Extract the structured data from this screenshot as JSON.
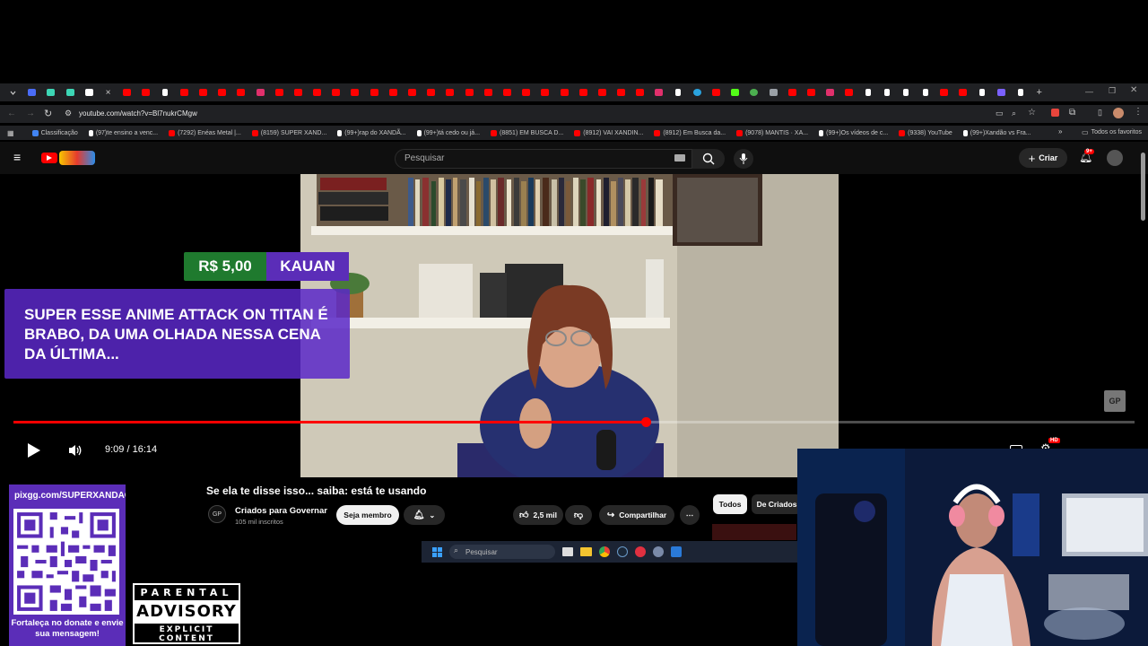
{
  "browser": {
    "url": "youtube.com/watch?v=Bl7nukrCMgw",
    "bookmarks": [
      {
        "label": "Classificação",
        "color": "#4285f4"
      },
      {
        "label": "(97)te ensino a venc...",
        "color": "#ffffff"
      },
      {
        "label": "(7292) Enéas Metal |...",
        "color": "#ff0000"
      },
      {
        "label": "(8159) SUPER XAND...",
        "color": "#ff0000"
      },
      {
        "label": "(99+)rap do XANDÃ...",
        "color": "#ffffff"
      },
      {
        "label": "(99+)tá cedo ou já...",
        "color": "#ffffff"
      },
      {
        "label": "(8851) EM BUSCA D...",
        "color": "#ff0000"
      },
      {
        "label": "(8912) VAI XANDIN...",
        "color": "#ff0000"
      },
      {
        "label": "(8912) Em Busca da...",
        "color": "#ff0000"
      },
      {
        "label": "(9078) MANTIS · XA...",
        "color": "#ff0000"
      },
      {
        "label": "(99+)Os vídeos de c...",
        "color": "#ffffff"
      },
      {
        "label": "(9338) YouTube",
        "color": "#ff0000"
      },
      {
        "label": "(99+)Xandão vs Fra...",
        "color": "#ffffff"
      }
    ],
    "all_bookmarks": "Todos os favoritos"
  },
  "youtube": {
    "search_placeholder": "Pesquisar",
    "create_label": "Criar",
    "notification_count": "9+"
  },
  "player": {
    "time": "9:09 / 16:14",
    "progress": 0.564
  },
  "overlay": {
    "amount": "R$ 5,00",
    "donor": "KAUAN",
    "message": "SUPER ESSE ANIME ATTACK ON TITAN É BRABO, DA UMA OLHADA NESSA CENA DA ÚLTIMA..."
  },
  "video": {
    "title": "Se ela te disse isso... saiba: está te usando",
    "channel": "Criados para Governar",
    "subscribers": "105 mil inscritos",
    "join_label": "Seja membro",
    "likes": "2,5 mil",
    "share_label": "Compartilhar",
    "chips": [
      "Todos",
      "De Criados"
    ]
  },
  "taskbar": {
    "search_placeholder": "Pesquisar"
  },
  "donate": {
    "url": "pixgg.com/SUPERXANDAO",
    "cta": "Fortaleça no donate e envie sua mensagem!"
  },
  "advisory": {
    "top": "PARENTAL",
    "mid": "ADVISORY",
    "bottom": "EXPLICIT CONTENT"
  }
}
